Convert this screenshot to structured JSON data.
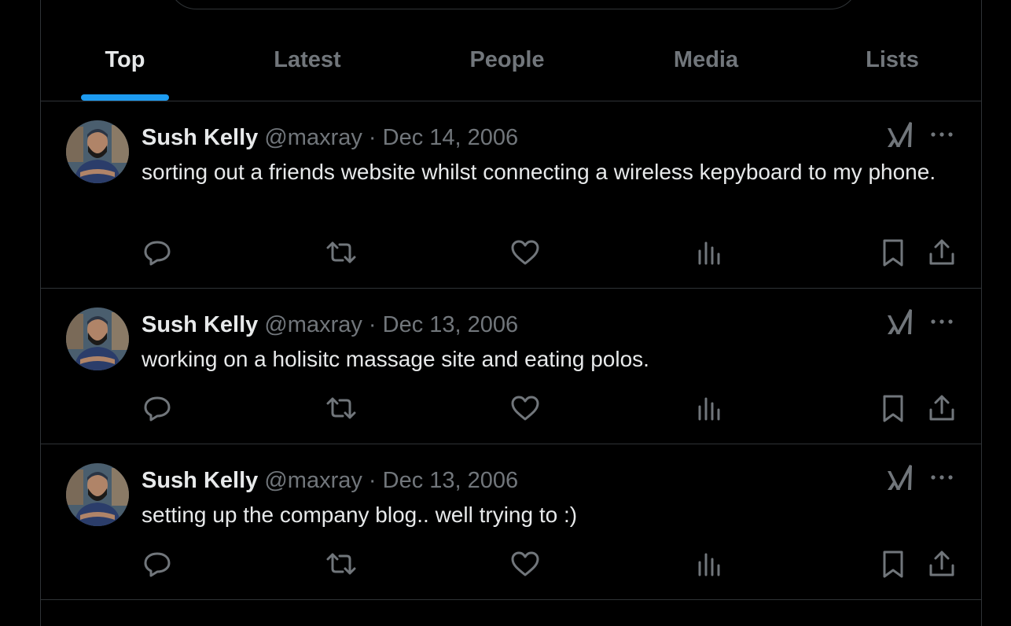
{
  "tabs": [
    {
      "label": "Top",
      "active": true
    },
    {
      "label": "Latest",
      "active": false
    },
    {
      "label": "People",
      "active": false
    },
    {
      "label": "Media",
      "active": false
    },
    {
      "label": "Lists",
      "active": false
    }
  ],
  "tweets": [
    {
      "name": "Sush Kelly",
      "handle": "@maxray",
      "separator": "·",
      "date": "Dec 14, 2006",
      "text": "sorting out a friends website  whilst connecting a wireless kepyboard to my phone."
    },
    {
      "name": "Sush Kelly",
      "handle": "@maxray",
      "separator": "·",
      "date": "Dec 13, 2006",
      "text": "working on a holisitc massage site and eating polos."
    },
    {
      "name": "Sush Kelly",
      "handle": "@maxray",
      "separator": "·",
      "date": "Dec 13, 2006",
      "text": "setting up the company blog.. well trying to :)"
    }
  ],
  "icons": {
    "reply": "reply-icon",
    "repost": "repost-icon",
    "like": "like-icon",
    "views": "views-icon",
    "bookmark": "bookmark-icon",
    "share": "share-icon",
    "grok": "grok-icon",
    "more": "more-icon"
  },
  "colors": {
    "background": "#000000",
    "text_primary": "#e7e9ea",
    "text_secondary": "#71767b",
    "accent": "#1d9bf0",
    "border": "#2f3336"
  }
}
